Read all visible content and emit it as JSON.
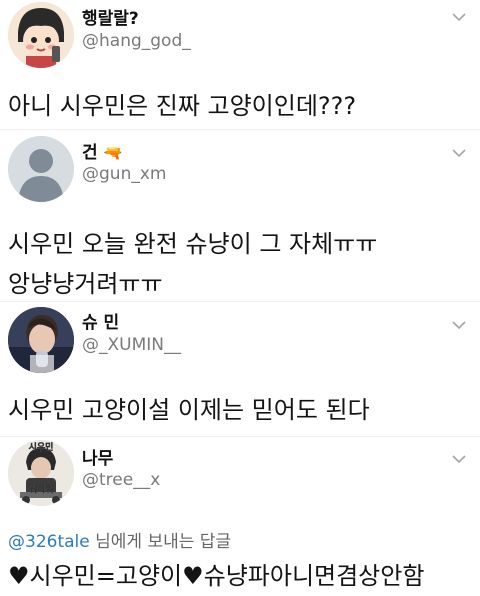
{
  "tweets": [
    {
      "name": "행랄랄?",
      "handle": "@hang_god_",
      "text": "아니 시우민은 진짜 고양이인데???"
    },
    {
      "name": "건",
      "name_emoji": "🔫",
      "handle": "@gun_xm",
      "text": "시우민 오늘 완전 슈냥이 그 자체ㅠㅠ 앙냥냥거려ㅠㅠ"
    },
    {
      "name": "슈 민",
      "handle": "@_XUMIN__",
      "text": "시우민 고양이설 이제는 믿어도 된다"
    },
    {
      "name": "나무",
      "handle": "@tree__x",
      "avatar_text": [
        "시우민",
        "귀여워"
      ]
    }
  ],
  "reply": {
    "mention": "@326tale",
    "suffix": "님에게 보내는 답글",
    "text": "♥시우민=고양이♥슈냥파아니면겸상안함"
  }
}
